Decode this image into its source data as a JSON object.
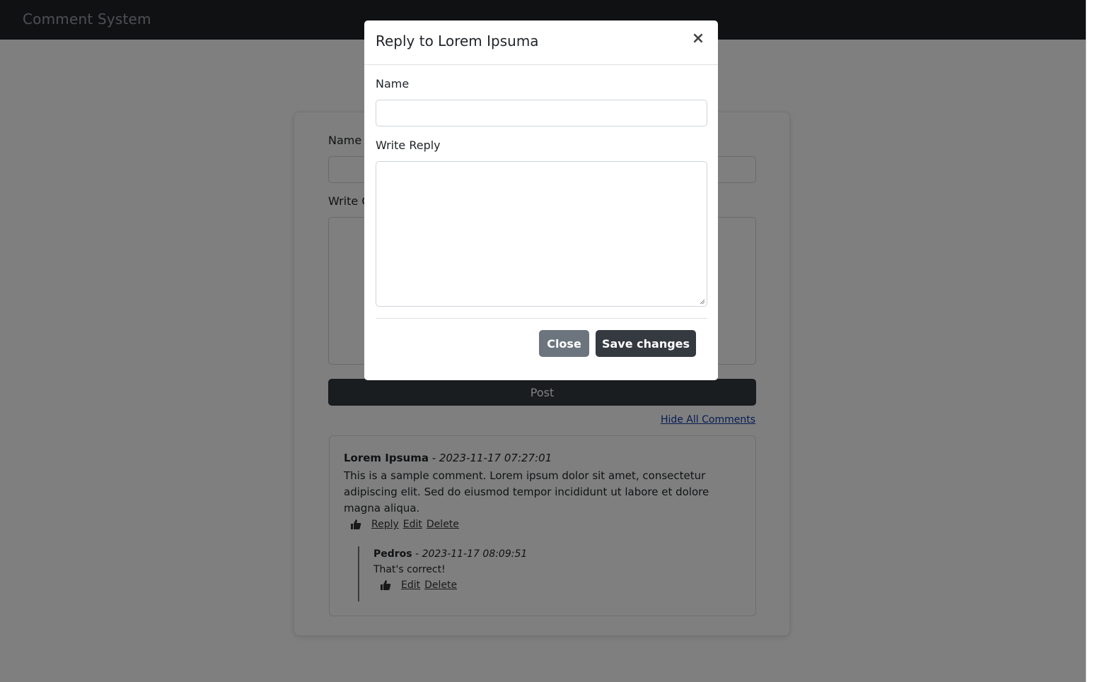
{
  "navbar": {
    "brand": "Comment System"
  },
  "form": {
    "name_label": "Name",
    "comment_label": "Write Comment",
    "post_button": "Post",
    "hide_link": "Hide All Comments"
  },
  "comments": [
    {
      "author": "Lorem Ipsuma",
      "separator": " - ",
      "date": "2023-11-17 07:27:01",
      "text": "This is a sample comment. Lorem ipsum dolor sit amet, consectetur adipiscing elit. Sed do eiusmod tempor incididunt ut labore et dolore magna aliqua.",
      "actions": [
        "Reply",
        "Edit",
        "Delete"
      ],
      "replies": [
        {
          "author": "Pedros",
          "separator": " - ",
          "date": "2023-11-17 08:09:51",
          "text": "That's correct!",
          "actions": [
            "Edit",
            "Delete"
          ]
        }
      ]
    }
  ],
  "modal": {
    "title": "Reply to Lorem Ipsuma",
    "close_icon": "×",
    "name_label": "Name",
    "name_value": "",
    "reply_label": "Write Reply",
    "reply_value": "",
    "close_button": "Close",
    "save_button": "Save changes"
  },
  "icons": {
    "like": "thumbs-up-icon",
    "close": "close-icon"
  },
  "colors": {
    "navbar": "#1f2327",
    "primary_dark": "#343a40",
    "secondary": "#6c757d",
    "link": "#0d3aa6"
  }
}
